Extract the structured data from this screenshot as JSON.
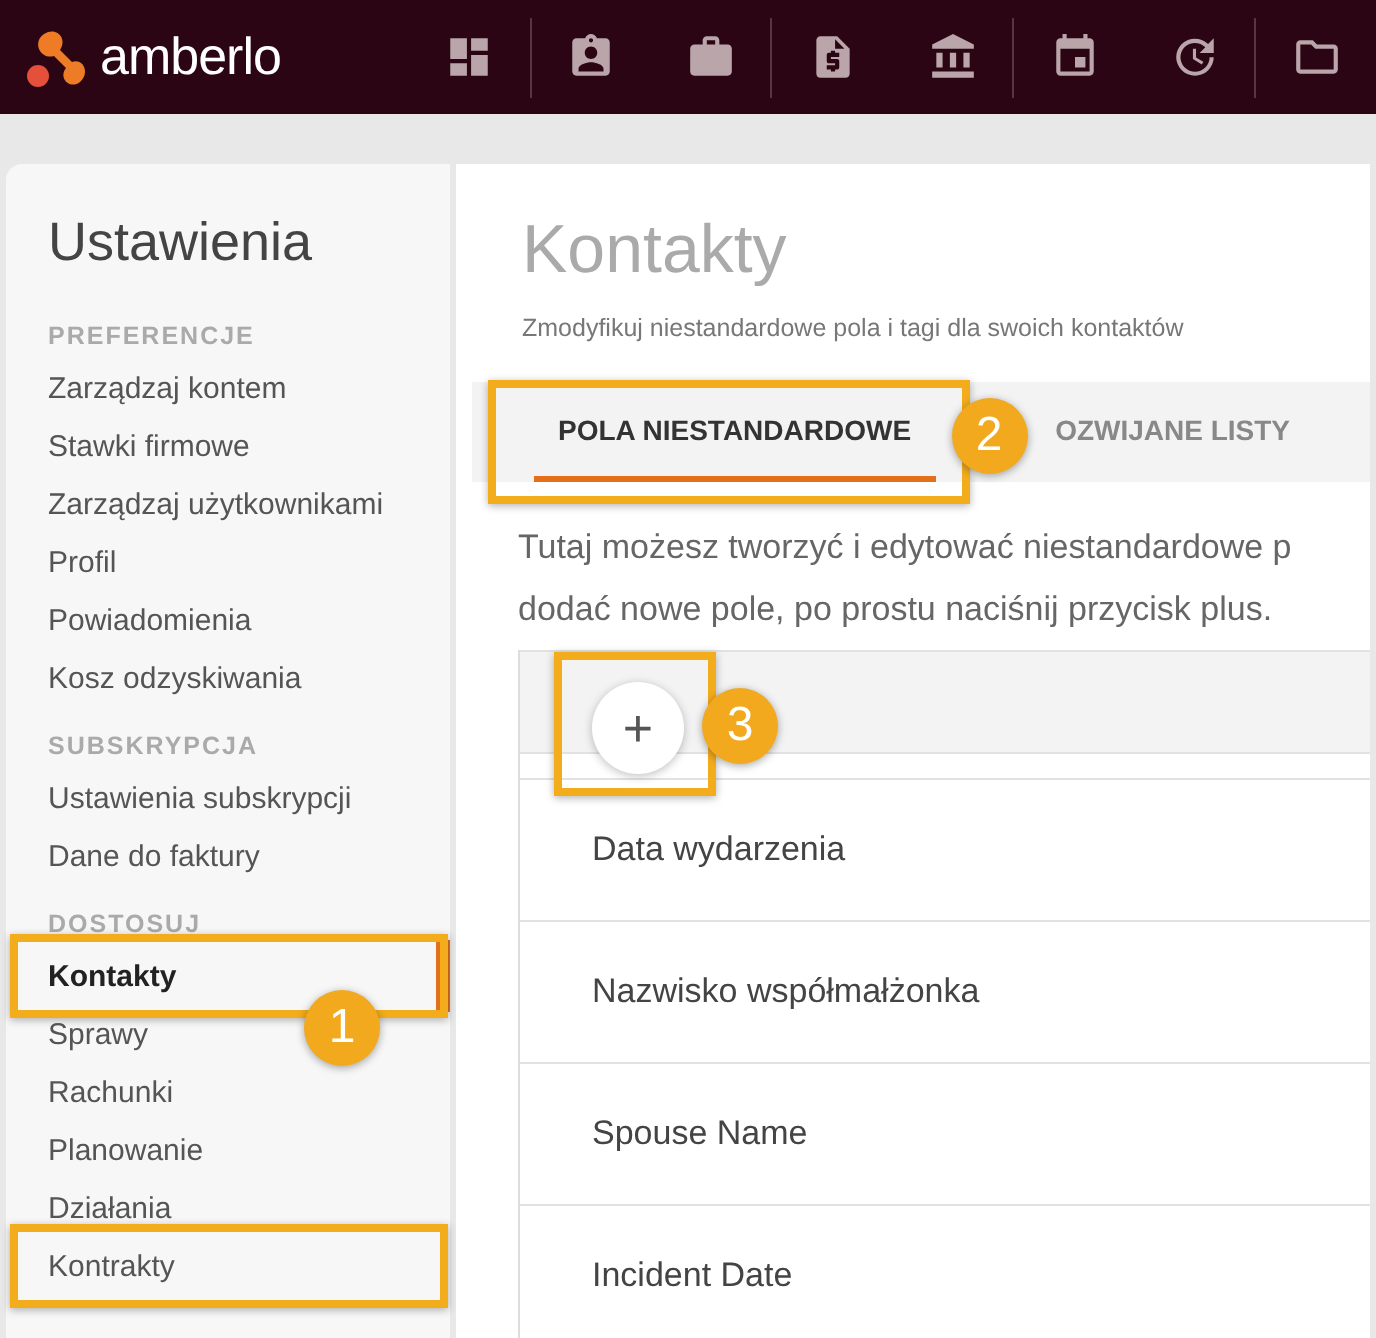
{
  "brand": {
    "name": "amberlo"
  },
  "sidebar": {
    "title": "Ustawienia",
    "sections": [
      {
        "heading": "PREFERENCJE",
        "items": [
          {
            "label": "Zarządzaj kontem",
            "selected": false,
            "highlighted": false
          },
          {
            "label": "Stawki firmowe",
            "selected": false,
            "highlighted": false
          },
          {
            "label": "Zarządzaj użytkownikami",
            "selected": false,
            "highlighted": false
          },
          {
            "label": "Profil",
            "selected": false,
            "highlighted": false
          },
          {
            "label": "Powiadomienia",
            "selected": false,
            "highlighted": false
          },
          {
            "label": "Kosz odzyskiwania",
            "selected": false,
            "highlighted": false
          }
        ]
      },
      {
        "heading": "SUBSKRYPCJA",
        "items": [
          {
            "label": "Ustawienia subskrypcji",
            "selected": false,
            "highlighted": false
          },
          {
            "label": "Dane do faktury",
            "selected": false,
            "highlighted": false
          }
        ]
      },
      {
        "heading": "DOSTOSUJ",
        "items": [
          {
            "label": "Kontakty",
            "selected": true,
            "highlighted": true,
            "callout": "1"
          },
          {
            "label": "Sprawy",
            "selected": false,
            "highlighted": false
          },
          {
            "label": "Rachunki",
            "selected": false,
            "highlighted": false
          },
          {
            "label": "Planowanie",
            "selected": false,
            "highlighted": false
          },
          {
            "label": "Działania",
            "selected": false,
            "highlighted": false
          },
          {
            "label": "Kontrakty",
            "selected": false,
            "highlighted": true
          }
        ]
      }
    ]
  },
  "main": {
    "title": "Kontakty",
    "subtitle": "Zmodyfikuj niestandardowe pola i tagi dla swoich kontaktów",
    "tabs": [
      {
        "label": "POLA NIESTANDARDOWE",
        "selected": true,
        "highlighted": true,
        "callout": "2"
      },
      {
        "label": "OZWIJANE LISTY",
        "selected": false,
        "highlighted": false
      }
    ],
    "intro": [
      "Tutaj możesz tworzyć i edytować niestandardowe p",
      "dodać nowe pole, po prostu naciśnij przycisk plus."
    ],
    "add_button": {
      "label": "+",
      "highlighted": true,
      "callout": "3"
    },
    "fields": [
      "Data wydarzenia",
      "Nazwisko współmałżonka",
      "Spouse Name",
      "Incident Date"
    ]
  }
}
